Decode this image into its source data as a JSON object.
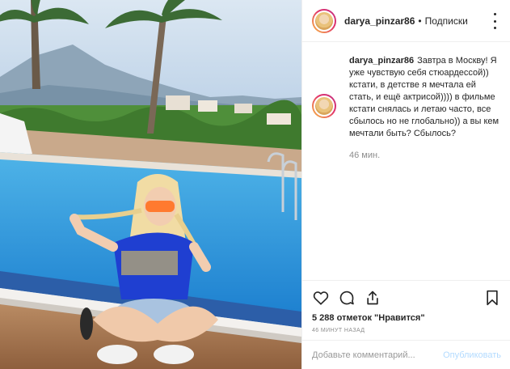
{
  "post": {
    "username": "darya_pinzar86",
    "separator": "•",
    "follow_label": "Подписки",
    "caption_text": "Завтра в Москву! Я уже чувствую себя стюардессой)) кстати, в детстве я мечтала ей стать, и ещё актрисой)))) в фильме кстати снялась и летаю часто, все сбылось но не глобально)) а вы кем мечтали быть? Сбылось?",
    "caption_time": "46 мин.",
    "likes_text": "5 288 отметок \"Нравится\"",
    "posted_time": "46 МИНУТ НАЗАД"
  },
  "comment": {
    "placeholder": "Добавьте комментарий...",
    "publish_label": "Опубликовать"
  },
  "icons": {
    "more": "more-options-icon",
    "like": "heart-icon",
    "comment": "comment-icon",
    "share": "share-icon",
    "save": "bookmark-icon"
  },
  "colors": {
    "link_disabled": "#b3dbff",
    "secondary_text": "#8e8e8e",
    "primary_text": "#262626",
    "border": "#efefef"
  }
}
